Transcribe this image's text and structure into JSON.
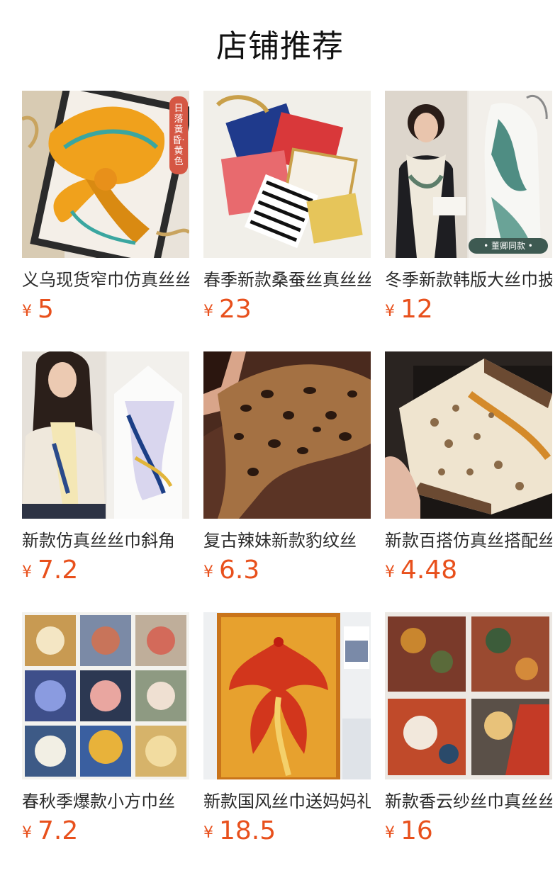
{
  "header": {
    "title": "店铺推荐"
  },
  "currency": "¥",
  "products": [
    {
      "name": "义乌现货窄巾仿真丝丝巾",
      "price": "5",
      "badge": "日落黄昏·黄色",
      "image": "orange-scarf-photo"
    },
    {
      "name": "春季新款桑蚕丝真丝丝巾",
      "price": "23",
      "image": "assorted-silk-scarves-photo"
    },
    {
      "name": "冬季新款韩版大丝巾披肩",
      "price": "12",
      "tag": "• 董卿同款 •",
      "image": "woman-with-scarf-photo"
    },
    {
      "name": "新款仿真丝丝巾斜角",
      "price": "7.2",
      "image": "neck-scarf-model-photo"
    },
    {
      "name": "复古辣妹新款豹纹丝",
      "price": "6.3",
      "image": "leopard-scarf-photo"
    },
    {
      "name": "新款百搭仿真丝搭配丝巾",
      "price": "4.48",
      "image": "monogram-scarf-photo"
    },
    {
      "name": "春秋季爆款小方巾丝",
      "price": "7.2",
      "image": "floral-square-scarves-photo"
    },
    {
      "name": "新款国风丝巾送妈妈礼物",
      "price": "18.5",
      "image": "phoenix-scarf-photo"
    },
    {
      "name": "新款香云纱丝巾真丝丝巾",
      "price": "16",
      "image": "painted-silk-scarves-photo"
    }
  ],
  "colors": {
    "price": "#e8501c",
    "badge": "#d55744"
  }
}
